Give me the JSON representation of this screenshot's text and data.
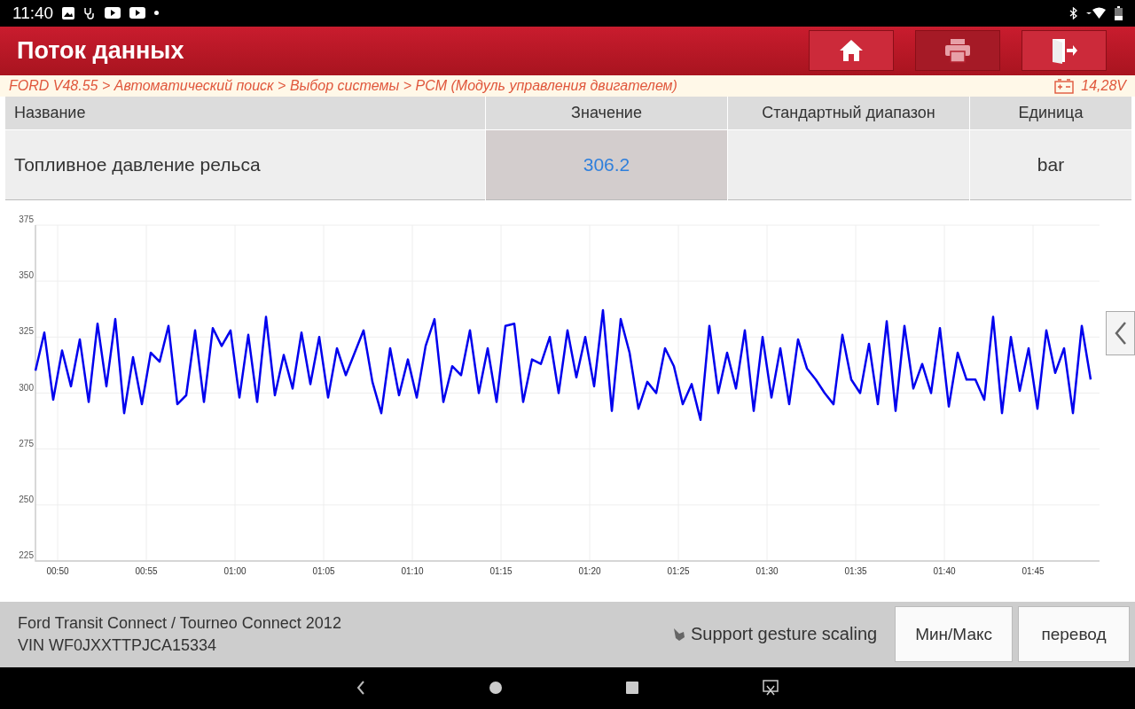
{
  "status_bar": {
    "time": "11:40"
  },
  "header": {
    "title": "Поток данных",
    "buttons": [
      {
        "kind": "home",
        "disabled": false
      },
      {
        "kind": "print",
        "disabled": true
      },
      {
        "kind": "exit",
        "disabled": false
      }
    ]
  },
  "breadcrumb": {
    "path": "FORD V48.55 > Автоматический поиск > Выбор системы > PCM (Модуль управления двигателем)",
    "voltage": "14,28V"
  },
  "table": {
    "columns": [
      "Название",
      "Значение",
      "Стандартный диапазон",
      "Единица"
    ],
    "rows": [
      {
        "name": "Топливное давление рельса",
        "value": "306.2",
        "range": "",
        "unit": "bar",
        "selected": true
      }
    ]
  },
  "chart_data": {
    "type": "line",
    "ylim": [
      225,
      375
    ],
    "xlim": [
      48.75,
      108.75
    ],
    "yticks": [
      225,
      250,
      275,
      300,
      325,
      350,
      375
    ],
    "xticks": [
      {
        "value": 50,
        "label": "00:50"
      },
      {
        "value": 55,
        "label": "00:55"
      },
      {
        "value": 60,
        "label": "01:00"
      },
      {
        "value": 65,
        "label": "01:05"
      },
      {
        "value": 70,
        "label": "01:10"
      },
      {
        "value": 75,
        "label": "01:15"
      },
      {
        "value": 80,
        "label": "01:20"
      },
      {
        "value": 85,
        "label": "01:25"
      },
      {
        "value": 90,
        "label": "01:30"
      },
      {
        "value": 95,
        "label": "01:35"
      },
      {
        "value": 100,
        "label": "01:40"
      },
      {
        "value": 105,
        "label": "01:45"
      }
    ],
    "grid": true,
    "x": [
      48.75,
      49.25,
      49.75,
      50.25,
      50.75,
      51.25,
      51.75,
      52.25,
      52.75,
      53.25,
      53.75,
      54.25,
      54.75,
      55.25,
      55.75,
      56.25,
      56.75,
      57.25,
      57.75,
      58.25,
      58.75,
      59.25,
      59.75,
      60.25,
      60.75,
      61.25,
      61.75,
      62.25,
      62.75,
      63.25,
      63.75,
      64.25,
      64.75,
      65.25,
      65.75,
      66.25,
      66.75,
      67.25,
      67.75,
      68.25,
      68.75,
      69.25,
      69.75,
      70.25,
      70.75,
      71.25,
      71.75,
      72.25,
      72.75,
      73.25,
      73.75,
      74.25,
      74.75,
      75.25,
      75.75,
      76.25,
      76.75,
      77.25,
      77.75,
      78.25,
      78.75,
      79.25,
      79.75,
      80.25,
      80.75,
      81.25,
      81.75,
      82.25,
      82.75,
      83.25,
      83.75,
      84.25,
      84.75,
      85.25,
      85.75,
      86.25,
      86.75,
      87.25,
      87.75,
      88.25,
      88.75,
      89.25,
      89.75,
      90.25,
      90.75,
      91.25,
      91.75,
      92.25,
      92.75,
      93.25,
      93.75,
      94.25,
      94.75,
      95.25,
      95.75,
      96.25,
      96.75,
      97.25,
      97.75,
      98.25,
      98.75,
      99.25,
      99.75,
      100.25,
      100.75,
      101.25,
      101.75,
      102.25,
      102.75,
      103.25,
      103.75,
      104.25,
      104.75,
      105.25,
      105.75,
      106.25,
      106.75,
      107.25,
      107.75,
      108.25
    ],
    "series": [
      {
        "color": "#0000ee",
        "values": [
          310,
          327,
          297,
          319,
          303,
          324,
          296,
          331,
          303,
          333,
          291,
          316,
          295,
          318,
          314,
          330,
          295,
          299,
          328,
          296,
          329,
          321,
          328,
          298,
          326,
          296,
          334,
          299,
          317,
          302,
          327,
          304,
          325,
          298,
          320,
          308,
          318,
          328,
          305,
          291,
          320,
          299,
          315,
          298,
          321,
          333,
          296,
          312,
          308,
          328,
          300,
          320,
          296,
          330,
          331,
          296,
          315,
          313,
          325,
          300,
          328,
          307,
          325,
          303,
          337,
          292,
          333,
          318,
          293,
          305,
          300,
          320,
          312,
          295,
          304,
          288,
          330,
          300,
          318,
          302,
          328,
          292,
          325,
          298,
          320,
          295,
          324,
          311,
          306,
          300,
          295,
          326,
          306,
          300,
          322,
          295,
          332,
          292,
          330,
          302,
          313,
          300,
          329,
          294,
          318,
          306,
          306,
          297,
          334,
          291,
          325,
          301,
          320,
          293,
          328,
          309,
          320,
          291,
          330,
          306
        ]
      }
    ]
  },
  "chart_side_button": {
    "kind": "collapse"
  },
  "footer": {
    "vehicle": "Ford Transit Connect / Tourneo Connect 2012",
    "vin": "VIN WF0JXXTTPJCA15334",
    "gesture": "Support gesture scaling",
    "buttons": [
      "Мин/Макс",
      "перевод"
    ]
  }
}
